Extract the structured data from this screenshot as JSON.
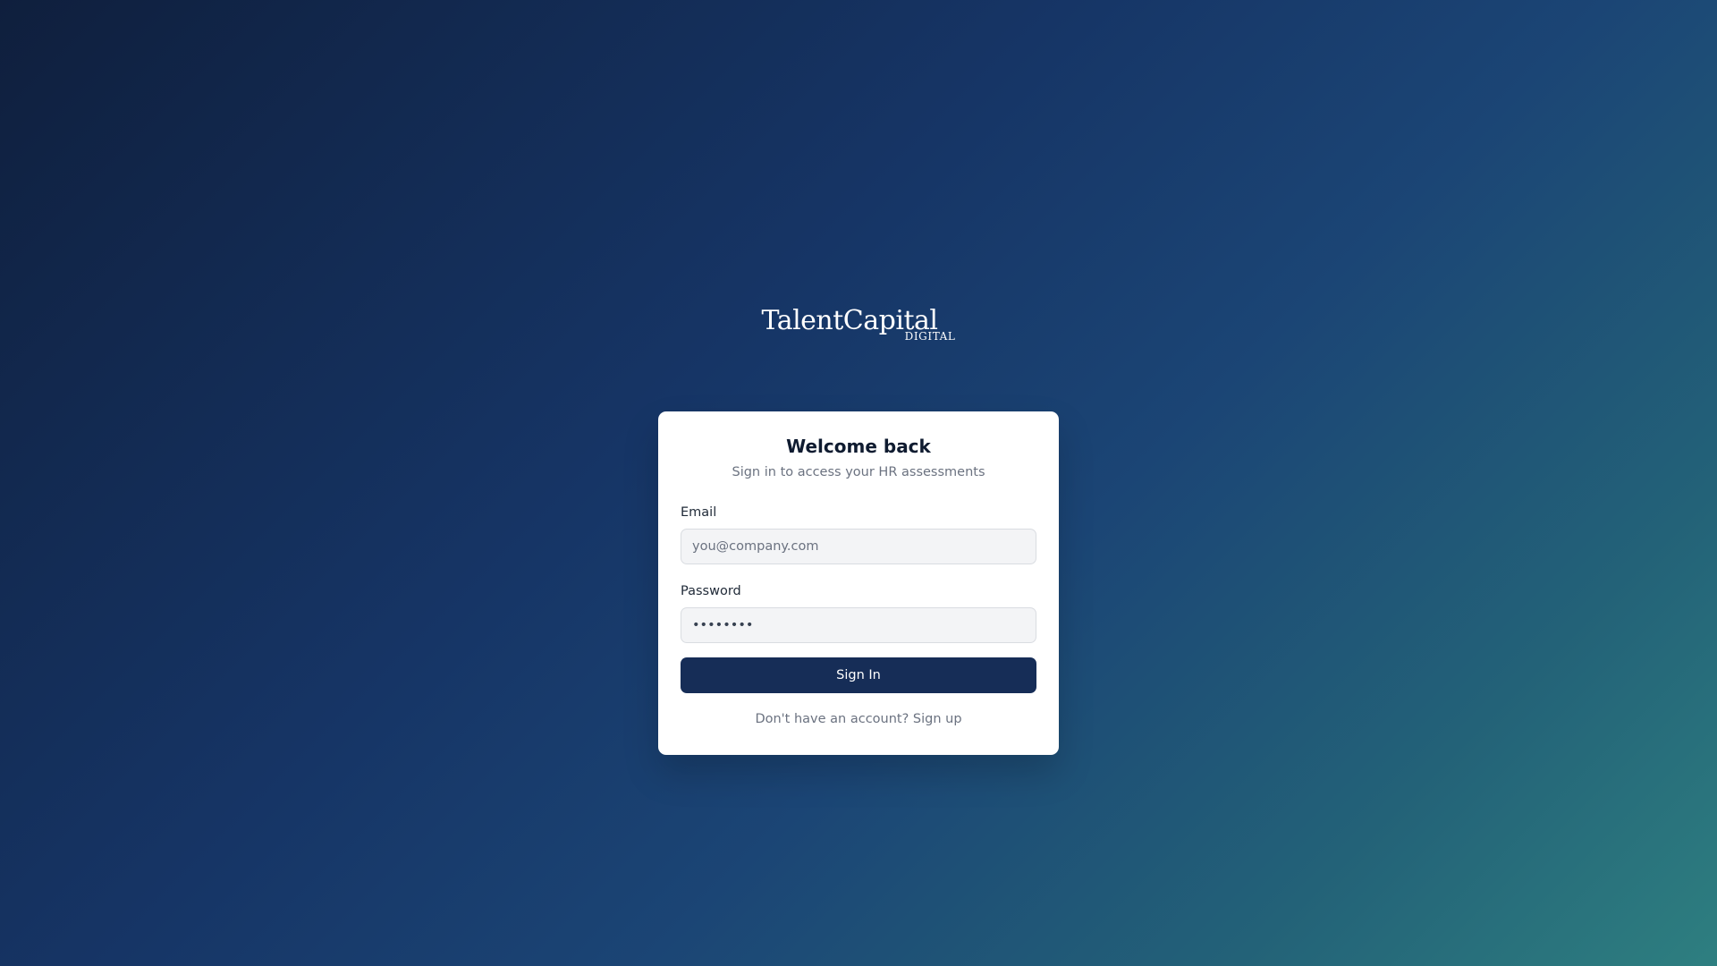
{
  "logo": {
    "main": "TalentCapital",
    "sub": "DIGITAL"
  },
  "card": {
    "title": "Welcome back",
    "subtitle": "Sign in to access your HR assessments"
  },
  "form": {
    "email_label": "Email",
    "email_placeholder": "you@company.com",
    "email_value": "",
    "password_label": "Password",
    "password_value": "password",
    "submit_label": "Sign In"
  },
  "footer": {
    "prompt": "Don't have an account?",
    "link_label": "Sign up"
  }
}
